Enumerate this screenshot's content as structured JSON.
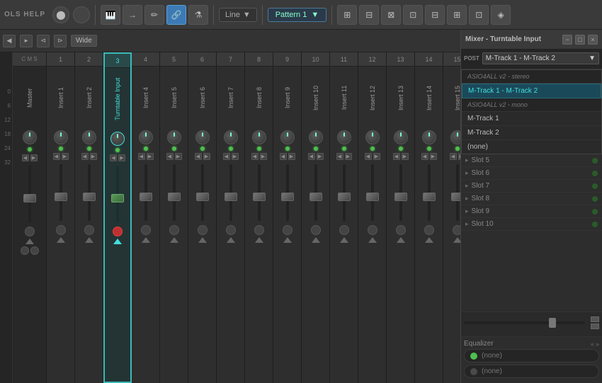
{
  "toolbar": {
    "help_label": "OLS HELP",
    "line_label": "Line",
    "pattern_label": "Pattern 1",
    "toolbar_buttons": [
      "◀",
      "▶",
      "⚡",
      "🔗",
      "🎤",
      "▶"
    ],
    "icons": [
      "piano",
      "arrow-right",
      "pencil",
      "link",
      "mic",
      "play"
    ]
  },
  "mixer_header": {
    "title": "Wide",
    "nav_icons": [
      "◀",
      "▸",
      "⊲",
      "⊳"
    ]
  },
  "channels": [
    {
      "id": "master",
      "number": "",
      "name": "Master",
      "type": "master"
    },
    {
      "id": "insert1",
      "number": "1",
      "name": "Insert 1",
      "type": "normal"
    },
    {
      "id": "insert2",
      "number": "2",
      "name": "Insert 2",
      "type": "normal"
    },
    {
      "id": "insert3",
      "number": "3",
      "name": "Turntable Input",
      "type": "highlighted"
    },
    {
      "id": "insert4",
      "number": "4",
      "name": "Insert 4",
      "type": "normal"
    },
    {
      "id": "insert5",
      "number": "5",
      "name": "Insert 5",
      "type": "normal"
    },
    {
      "id": "insert6",
      "number": "6",
      "name": "Insert 6",
      "type": "normal"
    },
    {
      "id": "insert7",
      "number": "7",
      "name": "Insert 7",
      "type": "normal"
    },
    {
      "id": "insert8",
      "number": "8",
      "name": "Insert 8",
      "type": "normal"
    },
    {
      "id": "insert9",
      "number": "9",
      "name": "Insert 9",
      "type": "normal"
    },
    {
      "id": "insert10",
      "number": "10",
      "name": "Insert 10",
      "type": "normal"
    },
    {
      "id": "insert11",
      "number": "11",
      "name": "Insert 11",
      "type": "normal"
    },
    {
      "id": "insert12",
      "number": "12",
      "name": "Insert 12",
      "type": "normal"
    },
    {
      "id": "insert13",
      "number": "13",
      "name": "Insert 13",
      "type": "normal"
    },
    {
      "id": "insert14",
      "number": "14",
      "name": "Insert 14",
      "type": "normal"
    },
    {
      "id": "insert15",
      "number": "15",
      "name": "Insert 15",
      "type": "normal"
    }
  ],
  "level_labels": [
    "0",
    "6",
    "12",
    "18",
    "24",
    "32"
  ],
  "mixer_popup": {
    "title": "Mixer - Turntable Input",
    "min_label": "−",
    "max_label": "□",
    "close_label": "×",
    "post_label": "POST",
    "track_selector_value": "M-Track 1 - M-Track 2",
    "dropdown_arrow": "▼",
    "input_items": [
      {
        "label": "ASIO4ALL v2 - stereo",
        "type": "section"
      },
      {
        "label": "M-Track 1 - M-Track 2",
        "type": "selected"
      },
      {
        "label": "ASIO4ALL v2 - mono",
        "type": "section"
      },
      {
        "label": "M-Track 1",
        "type": "normal"
      },
      {
        "label": "M-Track 2",
        "type": "normal"
      },
      {
        "label": "(none)",
        "type": "normal"
      }
    ],
    "slots": [
      {
        "label": "Slot 5",
        "active": false
      },
      {
        "label": "Slot 6",
        "active": false
      },
      {
        "label": "Slot 7",
        "active": false
      },
      {
        "label": "Slot 8",
        "active": false
      },
      {
        "label": "Slot 9",
        "active": false
      },
      {
        "label": "Slot 10",
        "active": false
      }
    ],
    "eq_label": "Equalizer",
    "eq_arrows": [
      "«",
      "»"
    ],
    "none_items": [
      "(none)",
      "(none)"
    ]
  }
}
